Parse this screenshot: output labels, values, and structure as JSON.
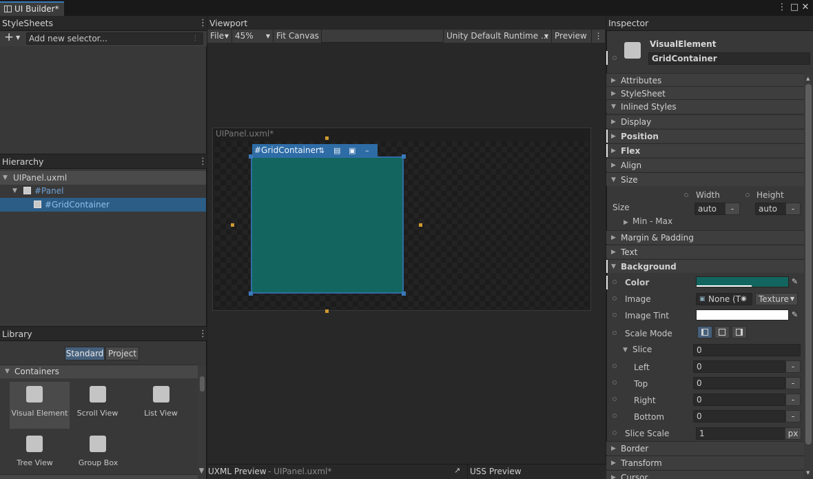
{
  "window": {
    "tab_title": "UI Builder*",
    "colors": {
      "accent": "#3a79bb",
      "selection": "#2c5d87",
      "element_bg": "#13665f",
      "handle": "#d09a30"
    }
  },
  "stylesheets": {
    "title": "StyleSheets",
    "add_label": "+",
    "selector_placeholder": "Add new selector..."
  },
  "hierarchy": {
    "title": "Hierarchy",
    "items": [
      {
        "label": "UIPanel.uxml"
      },
      {
        "label": "#Panel"
      },
      {
        "label": "#GridContainer"
      }
    ]
  },
  "library": {
    "title": "Library",
    "tabs": [
      "Standard",
      "Project"
    ],
    "section": "Containers",
    "items": [
      {
        "label": "Visual Element",
        "icon": "visual-element-icon"
      },
      {
        "label": "Scroll View",
        "icon": "scroll-view-icon"
      },
      {
        "label": "List View",
        "icon": "list-view-icon"
      },
      {
        "label": "Tree View",
        "icon": "tree-view-icon"
      },
      {
        "label": "Group Box",
        "icon": "group-box-icon"
      }
    ]
  },
  "viewport": {
    "title": "Viewport",
    "toolbar": {
      "file": "File",
      "zoom": "45%",
      "fit": "Fit Canvas",
      "theme": "Unity Default Runtime ...",
      "preview": "Preview"
    },
    "canvas_title": "UIPanel.uxml*",
    "selected_label": "#GridContainer"
  },
  "bottom": {
    "uxml_label": "UXML Preview",
    "uxml_file": "-  UIPanel.uxml*",
    "uss_label": "USS Preview"
  },
  "inspector": {
    "title": "Inspector",
    "element_type": "VisualElement",
    "element_name": "GridContainer",
    "sections": {
      "attributes": "Attributes",
      "stylesheet": "StyleSheet",
      "inlined": "Inlined Styles",
      "display": "Display",
      "position": "Position",
      "flex": "Flex",
      "align": "Align",
      "size": "Size",
      "margin": "Margin & Padding",
      "text": "Text",
      "background": "Background",
      "border": "Border",
      "transform": "Transform",
      "cursor": "Cursor"
    },
    "size": {
      "width_label": "Width",
      "height_label": "Height",
      "row_label": "Size",
      "width_value": "auto",
      "height_value": "auto",
      "unit": "-",
      "minmax": "Min - Max"
    },
    "background": {
      "color_label": "Color",
      "color_value": "#13665f",
      "image_label": "Image",
      "image_value": "None (T",
      "image_type": "Texture",
      "tint_label": "Image Tint",
      "tint_value": "#ffffff",
      "scale_label": "Scale Mode",
      "slice_label": "Slice",
      "slice_value": "0",
      "left_label": "Left",
      "left_value": "0",
      "top_label": "Top",
      "top_value": "0",
      "right_label": "Right",
      "right_value": "0",
      "bottom_label": "Bottom",
      "bottom_value": "0",
      "unit": "-",
      "slice_scale_label": "Slice Scale",
      "slice_scale_value": "1",
      "slice_scale_unit": "px"
    }
  }
}
